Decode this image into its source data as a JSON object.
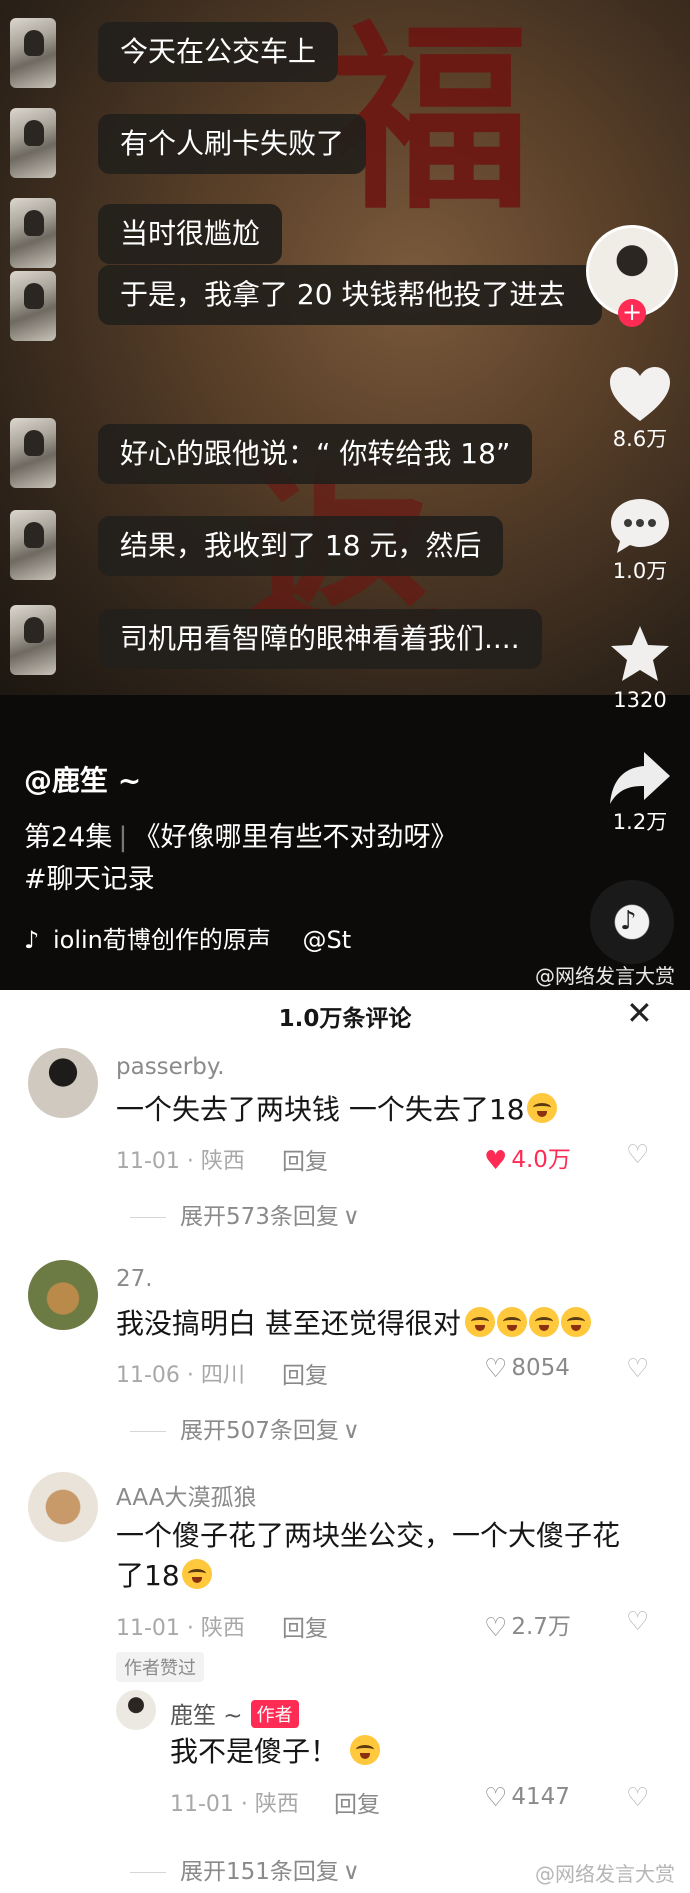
{
  "video": {
    "chat": [
      "今天在公交车上",
      "有个人刷卡失败了",
      "当时很尴尬",
      "于是，我拿了 20 块钱帮他投了进去",
      "好心的跟他说：“ 你转给我 18”",
      "结果，我收到了 18 元，然后",
      "司机用看智障的眼神看着我们...."
    ],
    "side": {
      "likes": "8.6万",
      "comments": "1.0万",
      "favorites": "1320",
      "shares": "1.2万"
    },
    "author": "@鹿笙 ~",
    "episode": "第24集",
    "title": "《好像哪里有些不对劲呀》",
    "hashtag": "#聊天记录",
    "music": "iolin荀博创作的原声",
    "music_at": "@St",
    "watermark": "@网络发言大赏"
  },
  "comments": {
    "header": "1.0万条评论",
    "items": [
      {
        "name": "passerby.",
        "text": "一个失去了两块钱 一个失去了18",
        "date": "11-01 · 陕西",
        "reply": "回复",
        "likes": "4.0万",
        "expand": "展开573条回复"
      },
      {
        "name": "27.",
        "text": "我没搞明白  甚至还觉得很对",
        "date": "11-06 · 四川",
        "reply": "回复",
        "likes": "8054",
        "expand": "展开507条回复"
      },
      {
        "name": "AAA大漠孤狼",
        "text": "一个傻子花了两块坐公交，一个大傻子花了18",
        "date": "11-01 · 陕西",
        "reply": "回复",
        "likes": "2.7万",
        "liked_by_author": "作者赞过"
      }
    ],
    "reply": {
      "name": "鹿笙 ~",
      "badge": "作者",
      "text": "我不是傻子！",
      "date": "11-01 · 陕西",
      "reply": "回复",
      "likes": "4147",
      "expand": "展开151条回复"
    },
    "watermark": "@网络发言大赏"
  },
  "colors": {
    "accent": "#fe2c55",
    "bubble": "#231f1b"
  }
}
